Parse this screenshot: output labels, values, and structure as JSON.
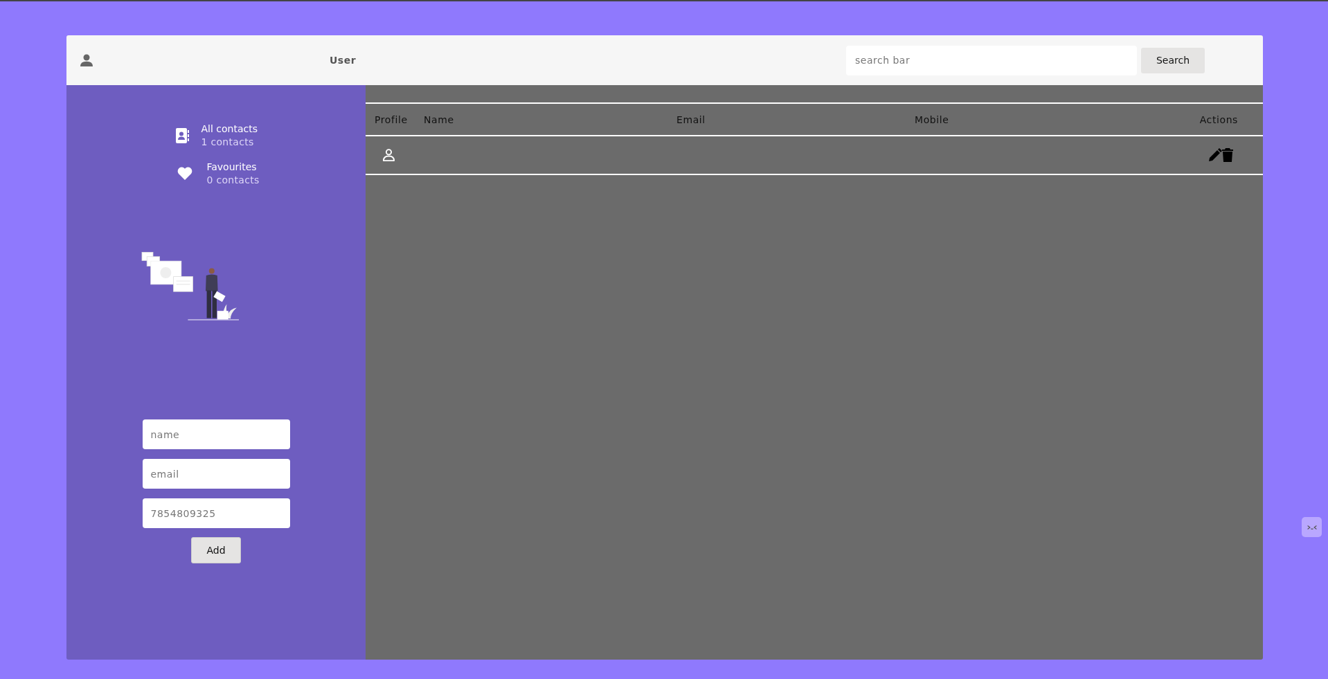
{
  "header": {
    "user_label": "User",
    "search": {
      "placeholder": "search bar"
    },
    "search_button": "Search"
  },
  "sidebar": {
    "categories": [
      {
        "kind": "contacts",
        "label": "All contacts",
        "count": "1 contacts"
      },
      {
        "kind": "favourites",
        "label": "Favourites",
        "count": "0 contacts"
      }
    ],
    "form": {
      "fields": [
        {
          "placeholder": "name"
        },
        {
          "placeholder": "email"
        },
        {
          "placeholder": "7854809325"
        }
      ],
      "add_button": "Add"
    }
  },
  "table": {
    "columns": [
      "Profile",
      "Name",
      "Email",
      "Mobile",
      "Actions"
    ],
    "rows": [
      {
        "kind": "contact"
      }
    ]
  }
}
